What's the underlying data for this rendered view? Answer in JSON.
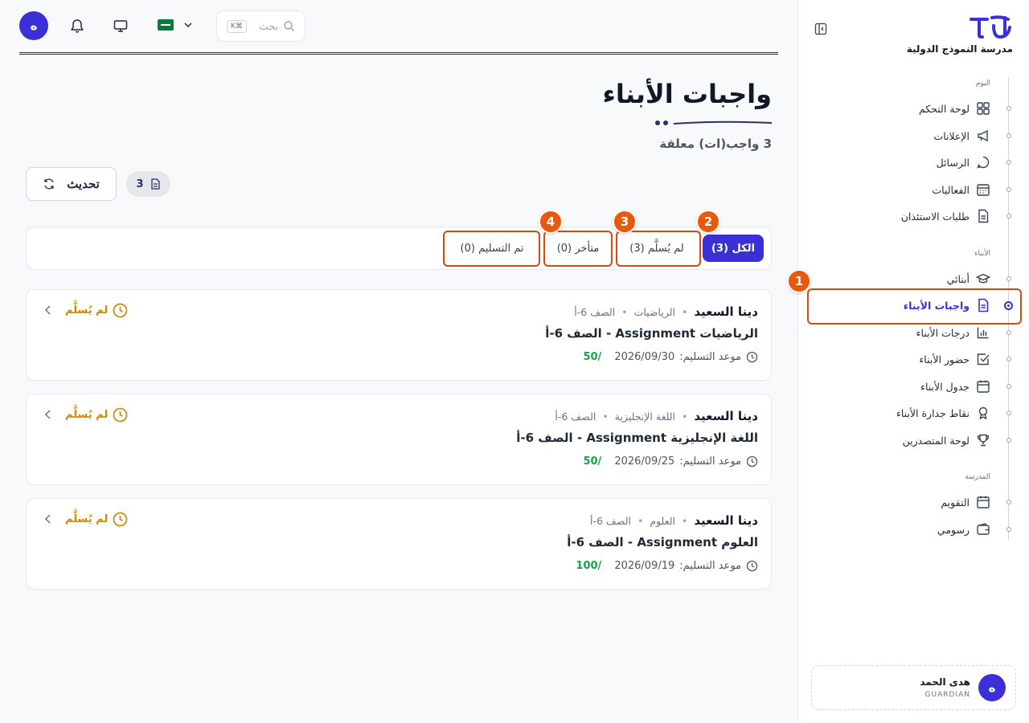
{
  "brand": {
    "school_name": "مدرسة النموذج الدولية"
  },
  "topbar": {
    "avatar_initial": "ه",
    "search_placeholder": "بحث",
    "search_shortcut": "K⌘"
  },
  "sidebar": {
    "sections": {
      "today": "اليوم",
      "children": "الأبناء",
      "school": "المدرسة"
    },
    "items": [
      {
        "label": "لوحة التحكم",
        "icon": "dashboard-icon"
      },
      {
        "label": "الإعلانات",
        "icon": "megaphone-icon"
      },
      {
        "label": "الرسائل",
        "icon": "chat-icon"
      },
      {
        "label": "الفعاليات",
        "icon": "calendar-grid-icon"
      },
      {
        "label": "طلبات الاستئذان",
        "icon": "document-icon"
      },
      {
        "label": "أبنائي",
        "icon": "graduation-cap-icon"
      },
      {
        "label": "واجبات الأبناء",
        "icon": "document-icon",
        "active": true
      },
      {
        "label": "درجات الأبناء",
        "icon": "bar-chart-icon"
      },
      {
        "label": "حضور الأبناء",
        "icon": "check-square-icon"
      },
      {
        "label": "جدول الأبناء",
        "icon": "calendar-icon"
      },
      {
        "label": "نقاط جدارة الأبناء",
        "icon": "award-icon"
      },
      {
        "label": "لوحة المتصدرين",
        "icon": "trophy-icon"
      },
      {
        "label": "التقويم",
        "icon": "calendar-icon"
      },
      {
        "label": "رسومي",
        "icon": "wallet-icon"
      }
    ]
  },
  "user": {
    "initial": "ه",
    "name": "هدى الحمد",
    "role": "GUARDIAN"
  },
  "page": {
    "title": "واجبات الأبناء",
    "subtitle": "3 واجب(ات) معلقة",
    "refresh_label": "تحديث",
    "count": "3"
  },
  "tabs": [
    {
      "label": "الكل (3)",
      "active": true
    },
    {
      "label": "لم يُسلَّم (3)"
    },
    {
      "label": "متأخر (0)"
    },
    {
      "label": "تم التسليم (0)"
    }
  ],
  "callouts": [
    "1",
    "2",
    "3",
    "4"
  ],
  "assignments": [
    {
      "student": "دينا السعيد",
      "subject": "الرياضيات",
      "class": "الصف 6-أ",
      "title": "الرياضيات Assignment - الصف 6-أ",
      "due_label": "موعد التسليم:",
      "due_date": "2026/09/30",
      "points": "50/",
      "status": "لم يُسلَّم"
    },
    {
      "student": "دينا السعيد",
      "subject": "اللغة الإنجليزية",
      "class": "الصف 6-أ",
      "title": "اللغة الإنجليزية Assignment - الصف 6-أ",
      "due_label": "موعد التسليم:",
      "due_date": "2026/09/25",
      "points": "50/",
      "status": "لم يُسلَّم"
    },
    {
      "student": "دينا السعيد",
      "subject": "العلوم",
      "class": "الصف 6-أ",
      "title": "العلوم Assignment - الصف 6-أ",
      "due_label": "موعد التسليم:",
      "due_date": "2026/09/19",
      "points": "100/",
      "status": "لم يُسلَّم"
    }
  ],
  "colors": {
    "accent": "#3b2fd6",
    "callout": "#e8590c",
    "status_pending": "#ca8a04",
    "points": "#16a34a"
  }
}
